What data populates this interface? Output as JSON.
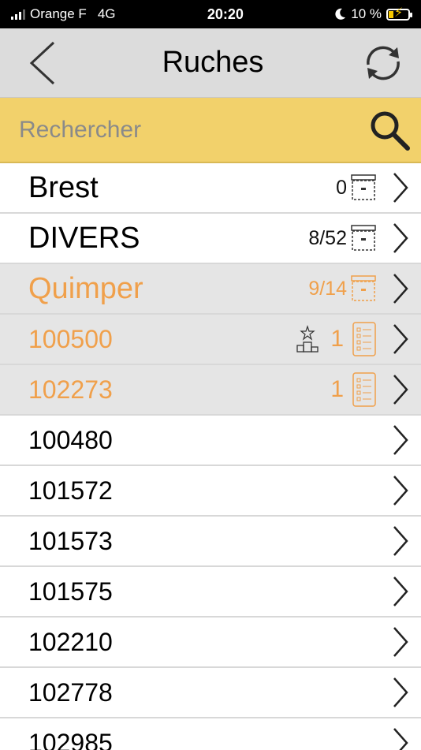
{
  "status_bar": {
    "carrier": "Orange F",
    "network": "4G",
    "time": "20:20",
    "battery": "10 %"
  },
  "nav": {
    "title": "Ruches",
    "back_icon": "chevron-left-icon",
    "refresh_icon": "refresh-icon"
  },
  "search": {
    "placeholder": "Rechercher",
    "icon": "search-icon"
  },
  "colors": {
    "accent": "#f0a04b",
    "search_bg": "#f2d16b",
    "nav_bg": "#dcdcdc",
    "shaded_row": "#e5e5e5"
  },
  "list": {
    "groups": [
      {
        "label": "Brest",
        "count": "0"
      },
      {
        "label": "DIVERS",
        "count": "8/52"
      },
      {
        "label": "Quimper",
        "count": "9/14"
      }
    ],
    "hives": [
      {
        "label": "100500",
        "count": "1"
      },
      {
        "label": "102273",
        "count": "1"
      },
      {
        "label": "100480"
      },
      {
        "label": "101572"
      },
      {
        "label": "101573"
      },
      {
        "label": "101575"
      },
      {
        "label": "102210"
      },
      {
        "label": "102778"
      },
      {
        "label": "102985"
      }
    ]
  }
}
